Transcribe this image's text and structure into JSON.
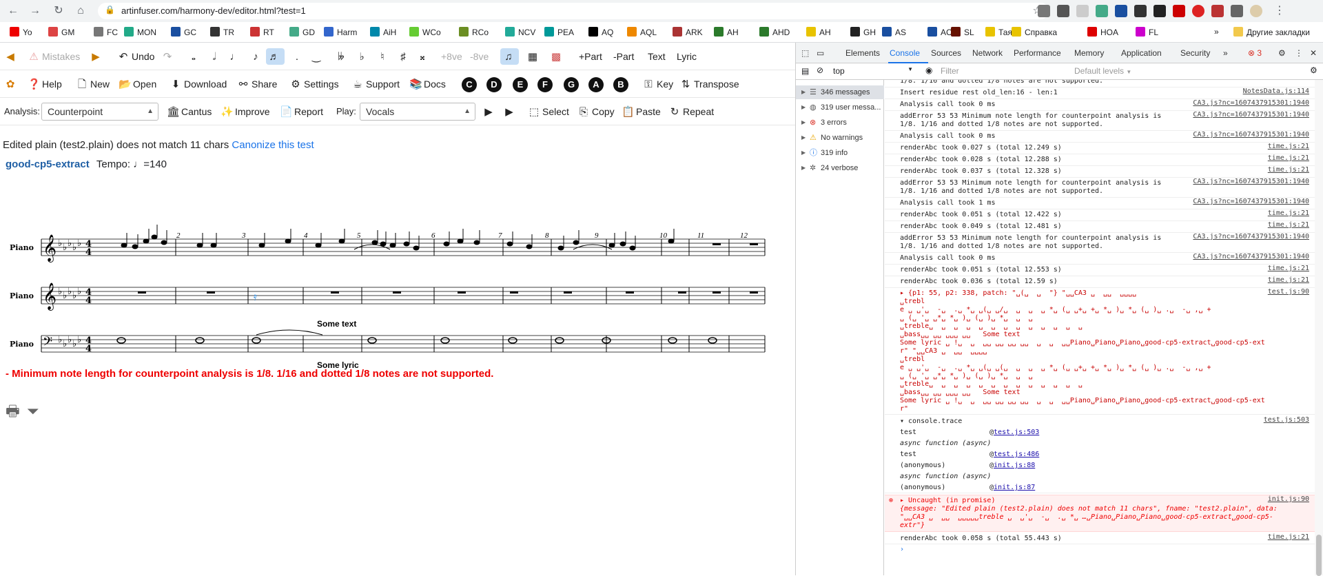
{
  "browser": {
    "url": "artinfuser.com/harmony-dev/editor.html?test=1",
    "bookmarks": [
      "Yo",
      "GM",
      "FC",
      "MON",
      "GC",
      "TR",
      "RT",
      "GD",
      "Harm",
      "AiH",
      "WCo",
      "RCo",
      "NCV",
      "PEA",
      "AQ",
      "AQL",
      "ARK",
      "AH",
      "AHD",
      "AH",
      "GH",
      "AS",
      "AC",
      "SL",
      "Тая",
      "Справка",
      "HOA",
      "FL"
    ],
    "other_bookmarks": "Другие закладки"
  },
  "toolbar1": {
    "mistakes": "Mistakes",
    "undo": "Undo",
    "up8": "+8ve",
    "down8": "-8ve",
    "add_part": "+Part",
    "remove_part": "-Part",
    "text": "Text",
    "lyric": "Lyric"
  },
  "toolbar2": {
    "help": "Help",
    "new": "New",
    "open": "Open",
    "download": "Download",
    "share": "Share",
    "settings": "Settings",
    "support": "Support",
    "docs": "Docs",
    "keys": [
      "C",
      "D",
      "E",
      "F",
      "G",
      "A",
      "B"
    ],
    "key": "Key",
    "transpose": "Transpose"
  },
  "toolbar3": {
    "analysis_label": "Analysis:",
    "analysis_value": "Counterpoint",
    "cantus": "Cantus",
    "improve": "Improve",
    "report": "Report",
    "play_label": "Play:",
    "play_value": "Vocals",
    "select": "Select",
    "copy": "Copy",
    "paste": "Paste",
    "repeat": "Repeat"
  },
  "status": {
    "error_text": "Edited plain (test2.plain) does not match 11 chars",
    "canonize_link": "Canonize this test",
    "piece_title": "good-cp5-extract",
    "tempo": "Tempo: ♩=140",
    "red_message": "- Minimum note length for counterpoint analysis is 1/8. 1/16 and dotted 1/8 notes are not supported."
  },
  "score": {
    "part_names": [
      "Piano",
      "Piano",
      "Piano"
    ],
    "measure_numbers": [
      "2",
      "3",
      "4",
      "5",
      "6",
      "7",
      "8",
      "9",
      "10",
      "11",
      "12"
    ],
    "text_annotation": "Some text",
    "lyric_annotation": "Some lyric"
  },
  "devtools": {
    "tabs": [
      "Elements",
      "Console",
      "Sources",
      "Network",
      "Performance",
      "Memory",
      "Application",
      "Security"
    ],
    "error_count": "3",
    "context": "top",
    "filter_placeholder": "Filter",
    "levels": "Default levels",
    "sidebar": [
      {
        "label": "346 messages",
        "icon": "list-icon"
      },
      {
        "label": "319 user messa...",
        "icon": "user-icon"
      },
      {
        "label": "3 errors",
        "icon": "error-icon"
      },
      {
        "label": "No warnings",
        "icon": "warning-icon"
      },
      {
        "label": "319 info",
        "icon": "info-icon"
      },
      {
        "label": "24 verbose",
        "icon": "bug-icon"
      }
    ],
    "console_lines": [
      {
        "text": "1/8. 1/16 and dotted 1/8 notes are not supported.",
        "src": ""
      },
      {
        "text": "Insert residue rest old_len:16 - len:1",
        "src": "NotesData.js:114"
      },
      {
        "text": "Analysis call took 0 ms",
        "src": "CA3.js?nc=1607437915301:1940"
      },
      {
        "text": "addError 53 53 Minimum note length for counterpoint analysis is\n1/8. 1/16 and dotted 1/8 notes are not supported.",
        "src": "CA3.js?nc=1607437915301:1940"
      },
      {
        "text": "Analysis call took 0 ms",
        "src": "CA3.js?nc=1607437915301:1940"
      },
      {
        "text": "renderAbc took 0.027 s (total 12.249 s)",
        "src": "time.js:21"
      },
      {
        "text": "renderAbc took 0.028 s (total 12.288 s)",
        "src": "time.js:21"
      },
      {
        "text": "renderAbc took 0.037 s (total 12.328 s)",
        "src": "time.js:21"
      },
      {
        "text": "addError 53 53 Minimum note length for counterpoint analysis is\n1/8. 1/16 and dotted 1/8 notes are not supported.",
        "src": "CA3.js?nc=1607437915301:1940"
      },
      {
        "text": "Analysis call took 1 ms",
        "src": "CA3.js?nc=1607437915301:1940"
      },
      {
        "text": "renderAbc took 0.051 s (total 12.422 s)",
        "src": "time.js:21"
      },
      {
        "text": "renderAbc took 0.049 s (total 12.481 s)",
        "src": "time.js:21"
      },
      {
        "text": "addError 53 53 Minimum note length for counterpoint analysis is\n1/8. 1/16 and dotted 1/8 notes are not supported.",
        "src": "CA3.js?nc=1607437915301:1940"
      },
      {
        "text": "Analysis call took 0 ms",
        "src": "CA3.js?nc=1607437915301:1940"
      },
      {
        "text": "renderAbc took 0.051 s (total 12.553 s)",
        "src": "time.js:21"
      },
      {
        "text": "renderAbc took 0.036 s (total 12.59 s)",
        "src": "time.js:21"
      }
    ],
    "object_dump": "▸ {p1: 55, p2: 338, patch: \"␣(␣  ␣  \"} \"␣␣CA3 ␣  ␣␣  ␣␣␣␣\n␣trebl\ne ␣ ␣'␣  -␣  .␣ *␣ ␣(␣ ␣/␣  ␣  ␣  ␣ *␣ (␣ ␣+␣ +␣ *␣ )␣ *␣ (␣ )␣ .␣  -␣ ,␣ +\n␣ (␣ '␣ ␣*␣ *␣ )␣ (␣ )␣ *␣  ␣  ␣\n␣treble␣  ␣  ␣  ␣  ␣  ␣  ␣  ␣  ␣  ␣  ␣  ␣  ␣\n␣bass␣␣ ␣␣ ␣␣␣ ␣␣   Some text\nSome lyric ␣ !␣  ␣  ␣␣ ␣␣ ␣␣ ␣␣  ␣  ␣  ␣␣Piano␣Piano␣Piano␣good-cp5-extract␣good-cp5-ext\nr\" \"␣␣CA3 ␣  ␣␣  ␣␣␣␣\n␣trebl\ne ␣ ␣'␣  -␣  .␣ *␣ ␣(␣ ␣(␣  ␣  ␣  ␣ *␣ (␣ ␣+␣ +␣ *␣ )␣ *␣ (␣ )␣ .␣  -␣ ,␣ +\n␣ (␣ '␣ ␣*␣ *␣ )␣ (␣ )␣ *␣  ␣  ␣\n␣treble␣  ␣  ␣  ␣  ␣  ␣  ␣  ␣  ␣  ␣  ␣  ␣  ␣\n␣bass␣␣ ␣␣ ␣␣␣ ␣␣   Some text\nSome lyric ␣ !␣  ␣  ␣␣ ␣␣ ␣␣ ␣␣  ␣  ␣  ␣␣Piano␣Piano␣Piano␣good-cp5-extract␣good-cp5-ext\nr\"",
    "object_src": "test.js:90",
    "trace_title": "▾ console.trace",
    "trace_src": "test.js:503",
    "trace": [
      {
        "fn": "test",
        "loc": "test.js:503"
      },
      {
        "fn": "async function (async)",
        "loc": ""
      },
      {
        "fn": "test",
        "loc": "test.js:486"
      },
      {
        "fn": "(anonymous)",
        "loc": "init.js:88"
      },
      {
        "fn": "async function (async)",
        "loc": ""
      },
      {
        "fn": "(anonymous)",
        "loc": "init.js:87"
      }
    ],
    "uncaught_title": "▸ Uncaught (in promise)",
    "uncaught_src": "init.js:90",
    "uncaught_body": "{message: \"Edited plain (test2.plain) does not match 11 chars\", fname: \"test2.plain\", data:\n\"␣␣CA3 ␣  ␣␣  ␣␣␣␣␣treble ␣  ␣'␣  -␣  .␣ *␣ …␣Piano␣Piano␣Piano␣good-cp5-extract␣good-cp5-\nextr\"}",
    "last_line": "renderAbc took 0.058 s (total 55.443 s)",
    "last_src": "time.js:21"
  },
  "colors": {
    "accent": "#1a73e8",
    "error": "#ee0000",
    "title": "#1f5fa5"
  }
}
